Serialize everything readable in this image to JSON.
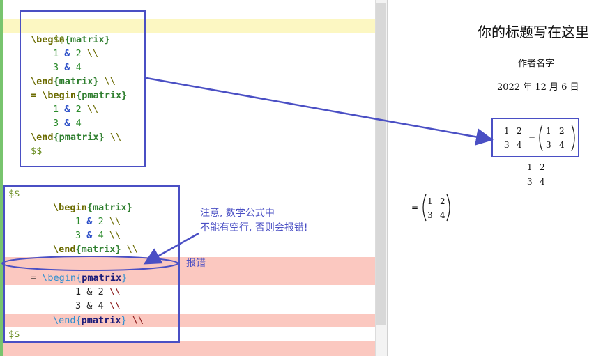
{
  "editor": {
    "block1": {
      "open": "$$",
      "begin_cmd": "\\begin",
      "env1": "matrix",
      "row1_a": "1",
      "row1_b": "2",
      "row2_a": "3",
      "row2_b": "4",
      "amp": "&",
      "linebreak": "\\\\",
      "end_cmd": "\\end",
      "eq": "=",
      "env2": "pmatrix",
      "close": "$$"
    },
    "block2": {
      "open": "$$",
      "begin_cmd": "\\begin",
      "env1": "matrix",
      "row1_a": "1",
      "row1_b": "2",
      "row2_a": "3",
      "row2_b": "4",
      "amp": "&",
      "linebreak": "\\\\",
      "end_cmd": "\\end",
      "eq": "=",
      "env2": "pmatrix",
      "close": "$$"
    }
  },
  "annotations": {
    "note_line1": "注意, 数学公式中",
    "note_line2": "不能有空行, 否则会报错!",
    "error_label": "报错"
  },
  "preview": {
    "title": "你的标题写在这里",
    "author": "作者名字",
    "date": "2022 年 12 月 6 日",
    "matrix": [
      [
        "1",
        "2"
      ],
      [
        "3",
        "4"
      ]
    ],
    "equals": "="
  },
  "colors": {
    "annotation": "#4a4fc4",
    "error_highlight": "#fbc8c0",
    "current_line": "#fcf7c2",
    "gutter": "#78c46e"
  }
}
